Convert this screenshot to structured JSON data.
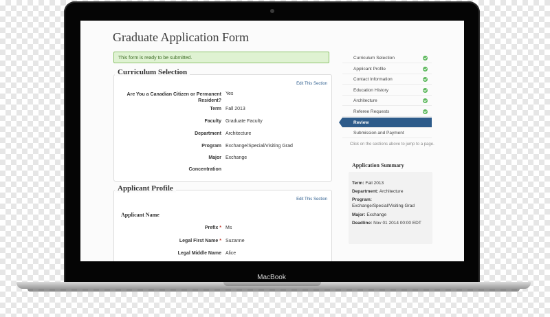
{
  "device": {
    "model_label": "MacBook"
  },
  "page": {
    "title": "Graduate Application Form",
    "alert": "This form is ready to be submitted."
  },
  "curriculum": {
    "title": "Curriculum Selection",
    "edit_label": "Edit This Section",
    "rows": [
      {
        "label": "Are You a Canadian Citizen or Permanent Resident?",
        "value": "Yes"
      },
      {
        "label": "Term",
        "value": "Fall 2013"
      },
      {
        "label": "Faculty",
        "value": "Graduate Faculty"
      },
      {
        "label": "Department",
        "value": "Architecture"
      },
      {
        "label": "Program",
        "value": "Exchange/Special/Visiting Grad"
      },
      {
        "label": "Major",
        "value": "Exchange"
      },
      {
        "label": "Concentration",
        "value": ""
      }
    ]
  },
  "applicant": {
    "title": "Applicant Profile",
    "edit_label": "Edit This Section",
    "subheading": "Applicant Name",
    "required_marker": "*",
    "rows": [
      {
        "label": "Prefix",
        "value": "Ms",
        "required": true
      },
      {
        "label": "Legal First Name",
        "value": "Suzanne",
        "required": true
      },
      {
        "label": "Legal Middle Name",
        "value": "Alice",
        "required": false
      }
    ]
  },
  "sidebar": {
    "items": [
      {
        "label": "Curriculum Selection",
        "complete": true
      },
      {
        "label": "Applicant Profile",
        "complete": true
      },
      {
        "label": "Contact Information",
        "complete": true
      },
      {
        "label": "Education History",
        "complete": true
      },
      {
        "label": "Architecture",
        "complete": true
      },
      {
        "label": "Referee Requests",
        "complete": true
      },
      {
        "label": "Review",
        "active": true
      },
      {
        "label": "Submission and Payment"
      }
    ],
    "hint": "Click on the sections above to jump to a page.",
    "summary": {
      "title": "Application Summary",
      "lines": [
        {
          "key": "Term:",
          "value": "Fall 2013"
        },
        {
          "key": "Department:",
          "value": "Architecture"
        },
        {
          "key": "Program:",
          "value": "Exchange/Special/Visiting Grad"
        },
        {
          "key": "Major:",
          "value": "Exchange"
        },
        {
          "key": "Deadline:",
          "value": "Nov 01 2014 00:00 EDT"
        }
      ]
    }
  },
  "colors": {
    "active_nav": "#2d5b8a",
    "alert_bg": "#dff2d2",
    "check": "#5cb85c"
  }
}
